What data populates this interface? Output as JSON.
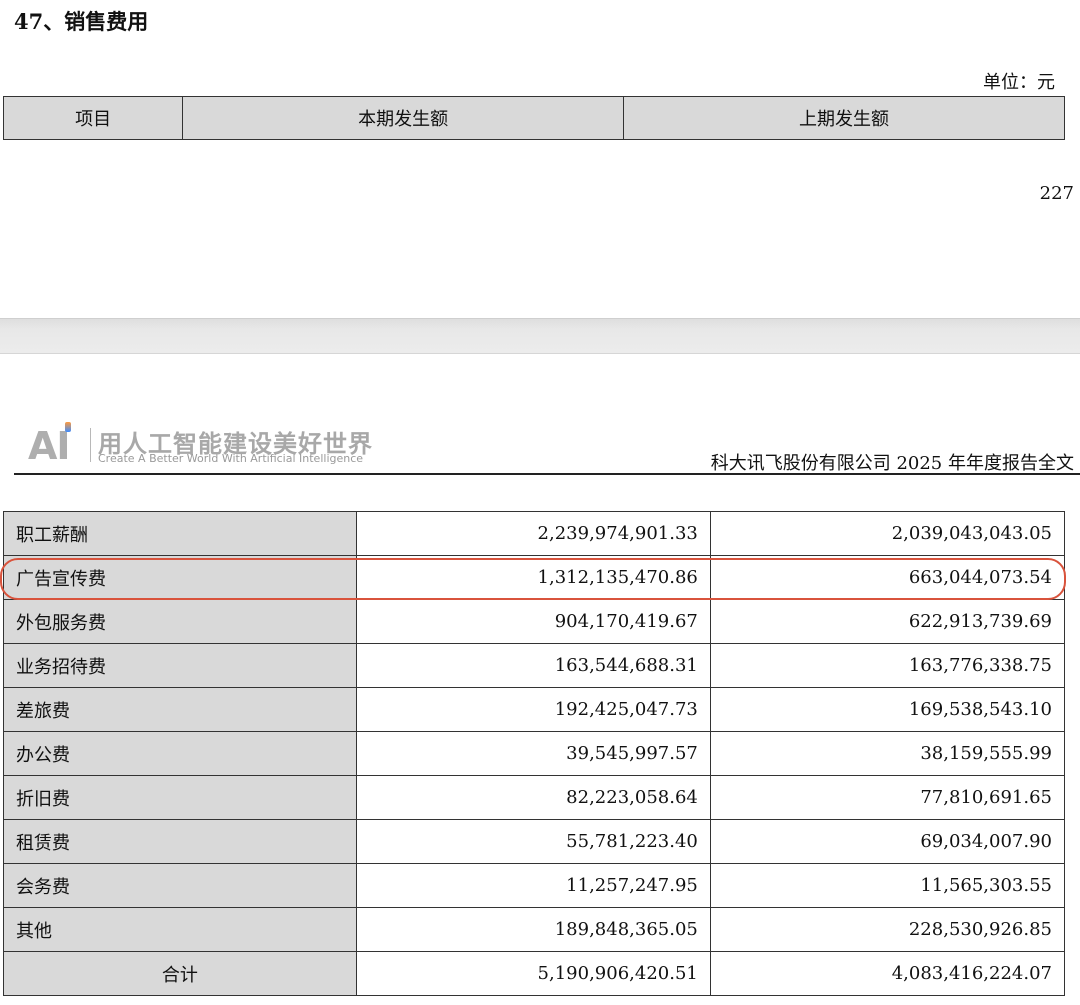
{
  "section_title": "47、销售费用",
  "unit_label": "单位：元",
  "table_header": {
    "item": "项目",
    "current": "本期发生额",
    "previous": "上期发生额"
  },
  "page_number": "227",
  "page_header": {
    "logo_mark": "AI",
    "logo_slogan_cn": "用人工智能建设美好世界",
    "logo_slogan_en": "Create A Better World With Artificial Intelligence",
    "company_report": "科大讯飞股份有限公司 2025 年年度报告全文"
  },
  "rows": [
    {
      "label": "职工薪酬",
      "current": "2,239,974,901.33",
      "previous": "2,039,043,043.05"
    },
    {
      "label": "广告宣传费",
      "current": "1,312,135,470.86",
      "previous": "663,044,073.54"
    },
    {
      "label": "外包服务费",
      "current": "904,170,419.67",
      "previous": "622,913,739.69"
    },
    {
      "label": "业务招待费",
      "current": "163,544,688.31",
      "previous": "163,776,338.75"
    },
    {
      "label": "差旅费",
      "current": "192,425,047.73",
      "previous": "169,538,543.10"
    },
    {
      "label": "办公费",
      "current": "39,545,997.57",
      "previous": "38,159,555.99"
    },
    {
      "label": "折旧费",
      "current": "82,223,058.64",
      "previous": "77,810,691.65"
    },
    {
      "label": "租赁费",
      "current": "55,781,223.40",
      "previous": "69,034,007.90"
    },
    {
      "label": "会务费",
      "current": "11,257,247.95",
      "previous": "11,565,303.55"
    },
    {
      "label": "其他",
      "current": "189,848,365.05",
      "previous": "228,530,926.85"
    }
  ],
  "total": {
    "label": "合计",
    "current": "5,190,906,420.51",
    "previous": "4,083,416,224.07"
  },
  "colors": {
    "header_fill": "#d9d9d9",
    "highlight_ring": "#d9533c"
  }
}
